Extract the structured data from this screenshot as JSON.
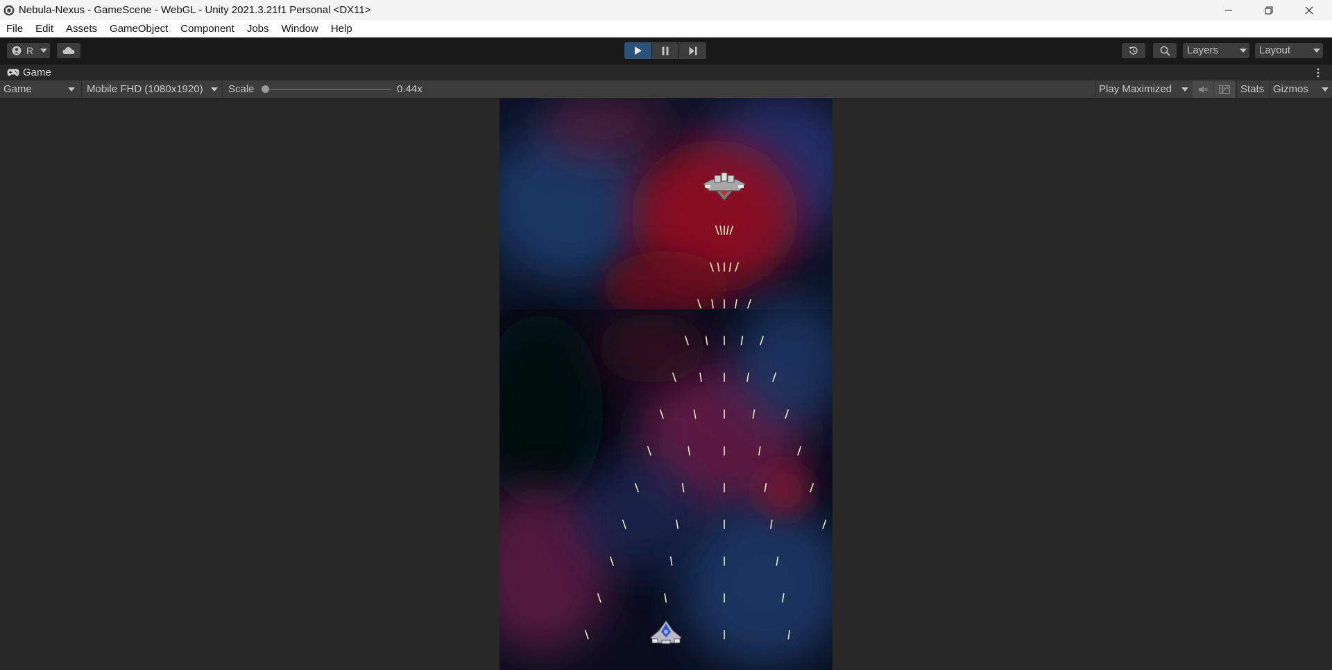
{
  "window": {
    "title": "Nebula-Nexus - GameScene - WebGL - Unity 2021.3.21f1 Personal <DX11>"
  },
  "menu": [
    "File",
    "Edit",
    "Assets",
    "GameObject",
    "Component",
    "Jobs",
    "Window",
    "Help"
  ],
  "toolbar": {
    "account_label": "R",
    "layers_label": "Layers",
    "layout_label": "Layout"
  },
  "game_tab": {
    "label": "Game"
  },
  "game_toolbar": {
    "display_label": "Game",
    "resolution_label": "Mobile FHD (1080x1920)",
    "scale_label": "Scale",
    "scale_value": "0.44x",
    "scale_fraction": 0.0,
    "play_mode_label": "Play Maximized",
    "stats_label": "Stats",
    "gizmos_label": "Gizmos"
  },
  "colors": {
    "play_active": "#2b5278",
    "nebula_red": "#8e1020",
    "nebula_blue": "#1d3a6a",
    "bullet": "#e6f2c4"
  },
  "icons": {
    "account": "account-icon",
    "cloud": "cloud-icon",
    "play": "play-icon",
    "pause": "pause-icon",
    "step": "step-icon",
    "history": "history-icon",
    "search": "search-icon",
    "kebab": "kebab-menu-icon",
    "mute": "mute-audio-icon",
    "shortcuts": "grid-icon"
  }
}
